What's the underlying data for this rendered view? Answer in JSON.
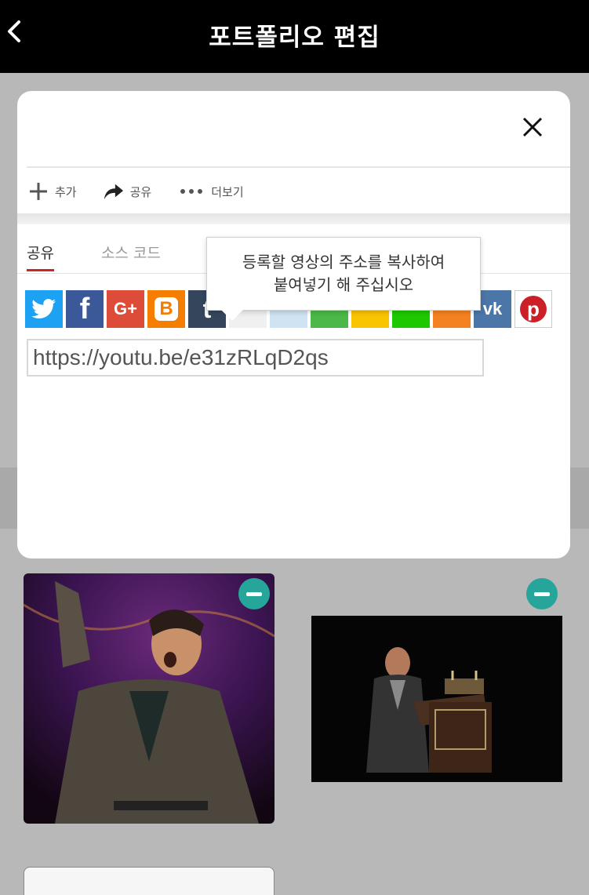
{
  "header": {
    "title": "포트폴리오 편집"
  },
  "toolbar": {
    "add_label": "추가",
    "share_label": "공유",
    "more_label": "더보기"
  },
  "tabs": [
    {
      "label": "공유"
    },
    {
      "label": "소스 코드"
    }
  ],
  "share_icons": [
    "twitter-icon",
    "facebook-icon",
    "google-plus-icon",
    "blogger-icon",
    "tumblr-icon",
    "vk-icon",
    "pinterest-icon"
  ],
  "url_value": "https://youtu.be/e31zRLqD2qs",
  "tooltip": {
    "line1": "등록할 영상의 주소를 복사하여",
    "line2": "붙여넣기 해 주십시오"
  },
  "colors": {
    "accent": "#c62828",
    "minus_button": "#26a69a",
    "header_bg": "#000000"
  }
}
